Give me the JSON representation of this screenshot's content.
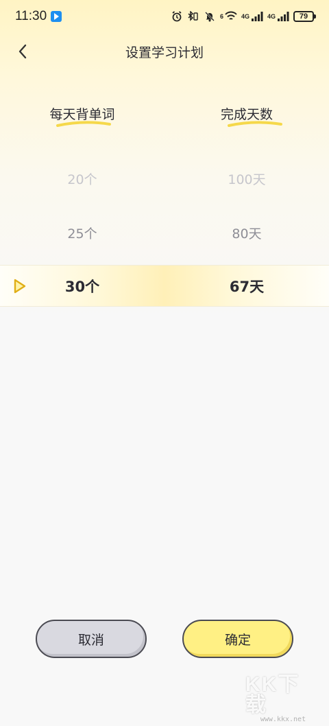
{
  "status_bar": {
    "time": "11:30",
    "network_1": "4G",
    "network_2": "4G",
    "wifi_label": "6",
    "battery": "79",
    "icons": [
      "alarm-icon",
      "bluetooth-icon",
      "vibrate-icon",
      "mute-icon",
      "wifi-icon",
      "signal-icon",
      "signal-icon"
    ]
  },
  "header": {
    "title": "设置学习计划",
    "back_icon": "chevron-left-icon"
  },
  "picker": {
    "left_header": "每天背单词",
    "right_header": "完成天数",
    "left_values": [
      "20个",
      "25个",
      "30个"
    ],
    "right_values": [
      "100天",
      "80天",
      "67天"
    ],
    "selected_index": 2,
    "selected_left": "30个",
    "selected_right": "67天"
  },
  "buttons": {
    "cancel": "取消",
    "confirm": "确定"
  },
  "watermark": {
    "logo": "KK下载",
    "url": "www.kkx.net"
  },
  "colors": {
    "accent_yellow": "#fff084",
    "cancel_gray": "#d9d9e0",
    "swoosh": "#f5d84a",
    "play_icon": "#e8b920"
  }
}
